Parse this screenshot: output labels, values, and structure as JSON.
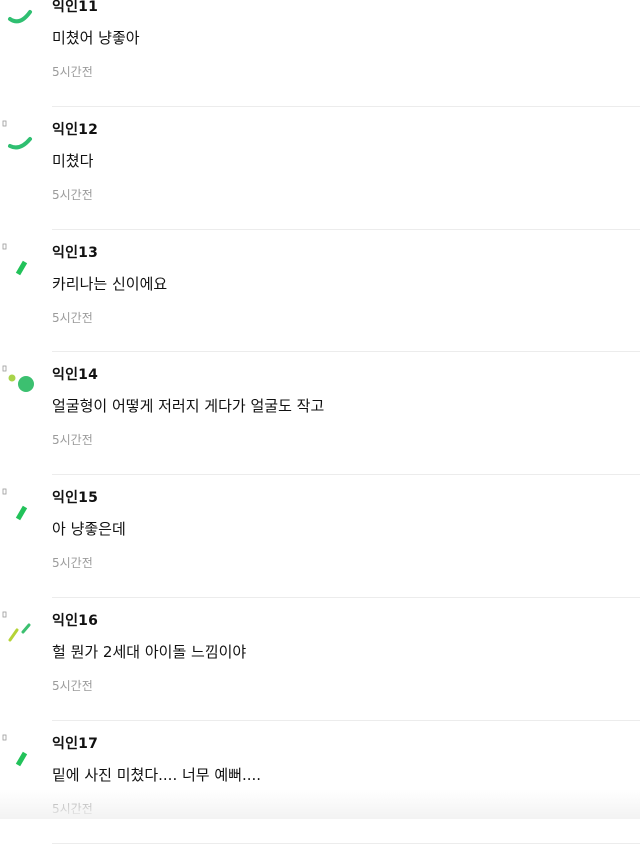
{
  "comments": [
    {
      "author": "익인11",
      "text": "미쳤어 냥좋아",
      "time": "5시간전",
      "avatar_icon": "green-arc-icon",
      "avatar_color": "#2fbf71"
    },
    {
      "author": "익인12",
      "text": "미쳤다",
      "time": "5시간전",
      "avatar_icon": "green-arc-icon",
      "avatar_color": "#2fbf71"
    },
    {
      "author": "익인13",
      "text": "카리나는 신이에요",
      "time": "5시간전",
      "avatar_icon": "green-slash-icon",
      "avatar_color": "#22c25a"
    },
    {
      "author": "익인14",
      "text": "얼굴형이 어떻게 저러지 게다가 얼굴도 작고",
      "time": "5시간전",
      "avatar_icon": "green-dots-icon",
      "avatar_color": "#3cc070"
    },
    {
      "author": "익인15",
      "text": "아 냥좋은데",
      "time": "5시간전",
      "avatar_icon": "green-slash-icon",
      "avatar_color": "#22c25a"
    },
    {
      "author": "익인16",
      "text": "헐 뭔가 2세대 아이돌 느낌이야",
      "time": "5시간전",
      "avatar_icon": "lime-marks-icon",
      "avatar_color": "#b5d336"
    },
    {
      "author": "익인17",
      "text": "밑에 사진 미쳤다.... 너무 예뻐....",
      "time": "5시간전",
      "avatar_icon": "green-slash-icon",
      "avatar_color": "#22c25a"
    }
  ]
}
